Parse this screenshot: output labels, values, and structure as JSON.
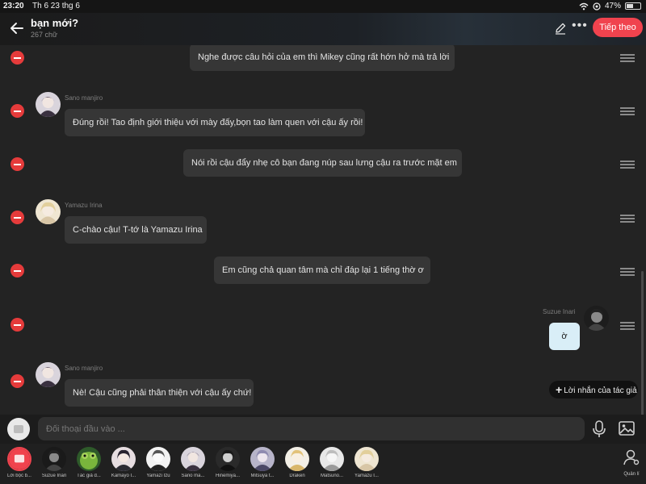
{
  "status_bar": {
    "time": "23:20",
    "date": "Th 6 23 thg 6",
    "battery": "47%",
    "battery_level": 0.47,
    "icons": [
      "wifi-icon",
      "location-icon",
      "battery-icon"
    ]
  },
  "header": {
    "title": "bạn mới?",
    "subtitle": "267 chữ",
    "next_label": "Tiếp theo",
    "more_label": "•••"
  },
  "messages": [
    {
      "id": "m1",
      "kind": "narration",
      "text": "Nghe được câu hỏi của em thì Mikey cũng rất hớn hở mà trả lời"
    },
    {
      "id": "m2",
      "kind": "left",
      "sender": "Sano manjiro",
      "avatar": "sano",
      "text": "Đúng rồi! Tao định giới thiệu với mày đấy,bọn tao làm quen với cậu ấy rồi!"
    },
    {
      "id": "m3",
      "kind": "narration",
      "text": "Nói rồi cậu đẩy nhẹ cô bạn đang núp sau lưng cậu ra trước mặt em"
    },
    {
      "id": "m4",
      "kind": "left",
      "sender": "Yamazu Irina",
      "avatar": "yamazu",
      "text": "C-chào cậu! T-tớ là Yamazu Irina"
    },
    {
      "id": "m5",
      "kind": "narration",
      "text": "Em cũng chả quan tâm mà chỉ đáp lại 1 tiếng thờ ơ"
    },
    {
      "id": "m6",
      "kind": "right",
      "sender": "Suzue Inari",
      "avatar": "suzue",
      "text": "ờ"
    },
    {
      "id": "m7",
      "kind": "left",
      "sender": "Sano manjiro",
      "avatar": "sano",
      "text": "Nè! Cậu cũng phải thân thiện với cậu ấy chứ!"
    }
  ],
  "author_note_label": "Lời nhắn của tác giả",
  "composer": {
    "placeholder": "Đối thoại đầu vào ..."
  },
  "characters": [
    {
      "label": "Lời bộc b...",
      "avatar": "narration",
      "selected": true
    },
    {
      "label": "Suzue Inari",
      "avatar": "suzue"
    },
    {
      "label": "Tác giả đ...",
      "avatar": "frog"
    },
    {
      "label": "Kamayo I...",
      "avatar": "kamayo"
    },
    {
      "label": "Yamazi Izu",
      "avatar": "yamazi"
    },
    {
      "label": "Sano ma...",
      "avatar": "sano"
    },
    {
      "label": "Hinemiya...",
      "avatar": "hinemiya"
    },
    {
      "label": "Mitsuya t...",
      "avatar": "mitsuya"
    },
    {
      "label": "Draken",
      "avatar": "draken"
    },
    {
      "label": "Matsuno...",
      "avatar": "matsuno"
    },
    {
      "label": "Yamazu I...",
      "avatar": "yamazu"
    }
  ],
  "manage_label": "Quản lí",
  "colors": {
    "accent": "#f0434e",
    "delete": "#e53b3b",
    "bubble": "#363636",
    "my_bubble": "#d9eef7"
  }
}
